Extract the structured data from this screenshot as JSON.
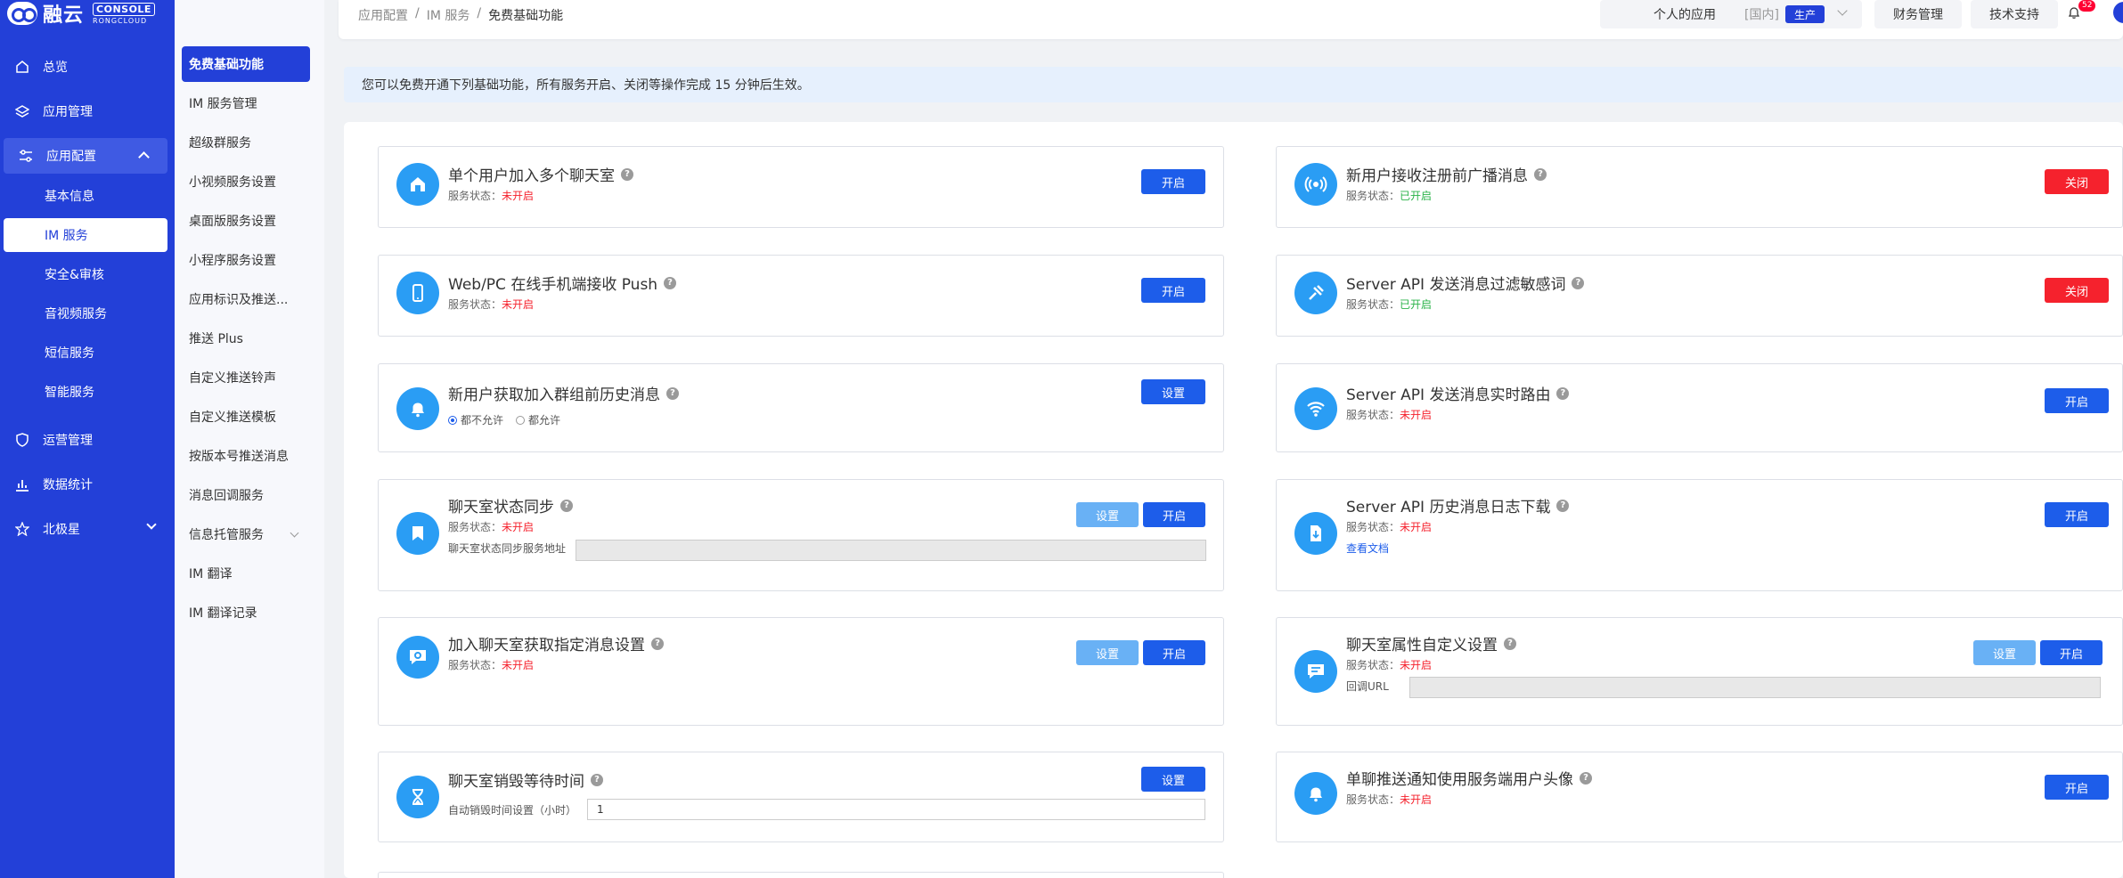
{
  "brand": {
    "name": "融云",
    "console_label": "CONSOLE",
    "sub_label": "RONGCLOUD"
  },
  "sidebar": {
    "items": [
      {
        "label": "总览",
        "icon": "home-icon"
      },
      {
        "label": "应用管理",
        "icon": "layers-icon"
      },
      {
        "label": "应用配置",
        "icon": "sliders-icon",
        "expanded": true
      },
      {
        "label": "运营管理",
        "icon": "shield-icon"
      },
      {
        "label": "数据统计",
        "icon": "bar-chart-icon"
      },
      {
        "label": "北极星",
        "icon": "star-icon"
      }
    ],
    "sub_items": [
      "基本信息",
      "IM 服务",
      "安全&审核",
      "音视频服务",
      "短信服务",
      "智能服务"
    ],
    "active_sub": "IM 服务"
  },
  "submenu": {
    "items": [
      "免费基础功能",
      "IM 服务管理",
      "超级群服务",
      "小视频服务设置",
      "桌面版服务设置",
      "小程序服务设置",
      "应用标识及推送...",
      "推送 Plus",
      "自定义推送铃声",
      "自定义推送模板",
      "按版本号推送消息",
      "消息回调服务",
      "信息托管服务",
      "IM 翻译",
      "IM 翻译记录"
    ],
    "active": "免费基础功能"
  },
  "breadcrumb": {
    "items": [
      "应用配置",
      "IM 服务"
    ],
    "current": "免费基础功能",
    "sep": "/"
  },
  "topbar": {
    "app_name": "个人的应用",
    "region": "[国内]",
    "env": "生产",
    "finance": "财务管理",
    "support": "技术支持",
    "notif_count": "52"
  },
  "notice": "您可以免费开通下列基础功能，所有服务开启、关闭等操作完成 15 分钟后生效。",
  "status_prefix": "服务状态：",
  "cards": {
    "c1": {
      "title": "单个用户加入多个聊天室",
      "status": "未开启",
      "btn": "开启",
      "icon": "house-icon"
    },
    "c2": {
      "title": "新用户接收注册前广播消息",
      "status": "已开启",
      "btn": "关闭",
      "icon": "broadcast-icon"
    },
    "c3": {
      "title": "Web/PC 在线手机端接收 Push",
      "status": "未开启",
      "btn": "开启",
      "icon": "phone-icon"
    },
    "c4": {
      "title": "Server API 发送消息过滤敏感词",
      "status": "已开启",
      "btn": "关闭",
      "icon": "filter-icon"
    },
    "c5": {
      "title": "新用户获取加入群组前历史消息",
      "btn": "设置",
      "icon": "bell-icon",
      "radio1": "都不允许",
      "radio2": "都允许"
    },
    "c6": {
      "title": "Server API 发送消息实时路由",
      "status": "未开启",
      "btn": "开启",
      "icon": "wifi-icon"
    },
    "c7": {
      "title": "聊天室状态同步",
      "status": "未开启",
      "btn_set": "设置",
      "btn": "开启",
      "icon": "bookmark-icon",
      "field_label": "聊天室状态同步服务地址"
    },
    "c8": {
      "title": "Server API 历史消息日志下载",
      "status": "未开启",
      "btn": "开启",
      "icon": "download-file-icon",
      "link": "查看文档"
    },
    "c9": {
      "title": "加入聊天室获取指定消息设置",
      "status": "未开启",
      "btn_set": "设置",
      "btn": "开启",
      "icon": "chat-settings-icon"
    },
    "c10": {
      "title": "聊天室属性自定义设置",
      "status": "未开启",
      "btn_set": "设置",
      "btn": "开启",
      "icon": "chat-icon",
      "field_label": "回调URL"
    },
    "c11": {
      "title": "聊天室销毁等待时间",
      "btn": "设置",
      "icon": "hourglass-icon",
      "field_label": "自动销毁时间设置（小时）",
      "field_value": "1"
    },
    "c12": {
      "title": "单聊推送通知使用服务端用户头像",
      "status": "未开启",
      "btn": "开启",
      "icon": "bell-icon"
    }
  },
  "colors": {
    "sidebar": "#2340d8",
    "primary": "#1d5dea",
    "danger": "#f5222d",
    "success": "#2bb34a",
    "icon_bg": "#2a9df4"
  }
}
